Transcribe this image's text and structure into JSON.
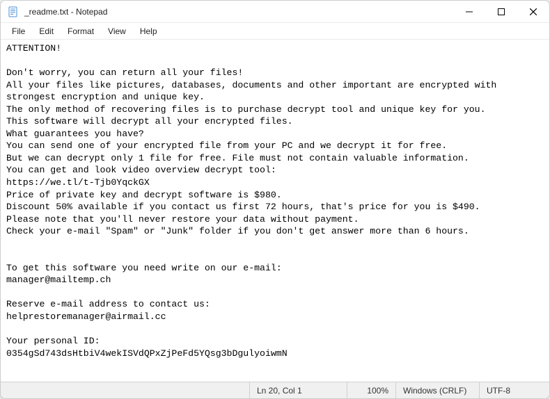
{
  "window": {
    "title": "_readme.txt - Notepad"
  },
  "menu": {
    "file": "File",
    "edit": "Edit",
    "format": "Format",
    "view": "View",
    "help": "Help"
  },
  "document": {
    "text": "ATTENTION!\n\nDon't worry, you can return all your files!\nAll your files like pictures, databases, documents and other important are encrypted with strongest encryption and unique key.\nThe only method of recovering files is to purchase decrypt tool and unique key for you.\nThis software will decrypt all your encrypted files.\nWhat guarantees you have?\nYou can send one of your encrypted file from your PC and we decrypt it for free.\nBut we can decrypt only 1 file for free. File must not contain valuable information.\nYou can get and look video overview decrypt tool:\nhttps://we.tl/t-Tjb0YqckGX\nPrice of private key and decrypt software is $980.\nDiscount 50% available if you contact us first 72 hours, that's price for you is $490.\nPlease note that you'll never restore your data without payment.\nCheck your e-mail \"Spam\" or \"Junk\" folder if you don't get answer more than 6 hours.\n\n\nTo get this software you need write on our e-mail:\nmanager@mailtemp.ch\n\nReserve e-mail address to contact us:\nhelprestoremanager@airmail.cc\n\nYour personal ID:\n0354gSd743dsHtbiV4wekISVdQPxZjPeFd5YQsg3bDgulyoiwmN"
  },
  "statusbar": {
    "position": "Ln 20, Col 1",
    "zoom": "100%",
    "line_ending": "Windows (CRLF)",
    "encoding": "UTF-8"
  }
}
